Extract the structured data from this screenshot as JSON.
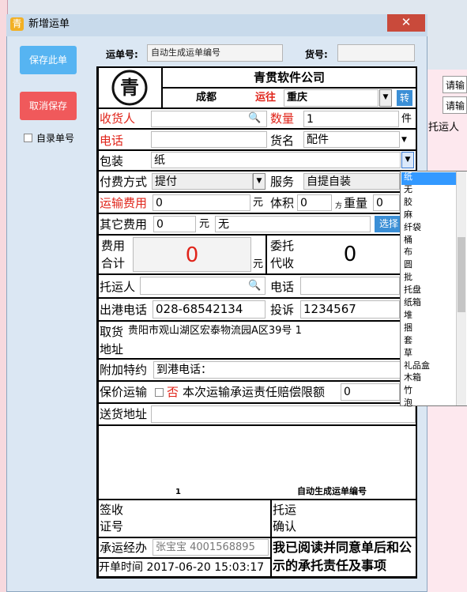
{
  "window": {
    "title": "新增运单",
    "close_label": "✕"
  },
  "left": {
    "save_label": "保存此单",
    "cancel_label": "取消保存",
    "manual_label": "自录单号"
  },
  "header": {
    "waybill_label": "运单号:",
    "waybill_value": "自动生成运单编号",
    "cargo_label": "货号:",
    "cargo_value": ""
  },
  "form": {
    "company": "青贯软件公司",
    "from": "成都",
    "route": "运往",
    "to": "重庆",
    "transfer": "转",
    "receiver": "收货人",
    "qty": "数量",
    "qty_val": "1",
    "qty_unit": "件",
    "phone": "电话",
    "goods": "货名",
    "goods_val": "配件",
    "pack": "包装",
    "pack_val": "纸",
    "pay": "付费方式",
    "pay_val": "提付",
    "service": "服务",
    "service_val": "自提自装",
    "freight": "运输费用",
    "freight_val": "0",
    "yuan": "元",
    "volume": "体积",
    "volume_val": "0",
    "volume_unit": "方",
    "weight": "重量",
    "weight_val": "0",
    "other": "其它费用",
    "other_val": "0",
    "other_unit": "元",
    "other_desc": "无",
    "choose": "选择",
    "total": "费用\n合计",
    "total_val": "0",
    "total_unit": "元",
    "collect": "委托\n代收",
    "collect_val": "0",
    "shipper": "托运人",
    "shipper_phone": "电话",
    "port_phone": "出港电话",
    "port_phone_val": "028-68542134",
    "complaint": "投诉",
    "complaint_val": "1234567",
    "pickup": "取货\n地址",
    "pickup_val": "贵阳市观山湖区宏泰物流园A区39号 1",
    "extra": "附加特约",
    "extra_val": "到港电话：",
    "insure": "保价运输",
    "insure_no": "否",
    "insure_text": "本次运输承运责任赔偿限额",
    "insure_val": "0",
    "delivery": "送货地址",
    "blank_num": "1",
    "blank_code": "自动生成运单编号",
    "sign": "签收\n证号",
    "confirm": "托运\n确认",
    "handler": "承运经办",
    "handler_val": "张宝宝 4001568895",
    "agree": "我已阅读并同意单后和公示的承托责任及事项",
    "time": "开单时间 2017-06-20 15:03:17"
  },
  "pack_list": [
    "纸",
    "无",
    "胶",
    "麻",
    "纤袋",
    "桶",
    "布",
    "圆",
    "批",
    "托盘",
    "纸箱",
    "堆",
    "捆",
    "套",
    "草",
    "礼品盒",
    "木箱",
    "竹",
    "泡"
  ],
  "bg": {
    "col_a": "请输",
    "col_b": "请输",
    "col_c": "托运人"
  }
}
